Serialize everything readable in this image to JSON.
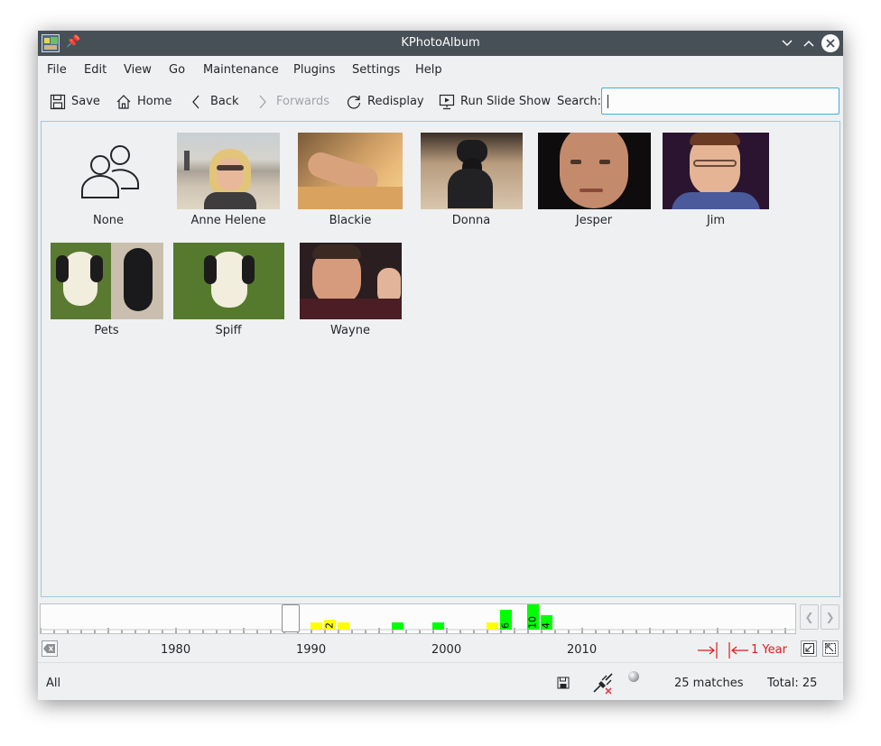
{
  "window": {
    "title": "KPhotoAlbum"
  },
  "menu": [
    "File",
    "Edit",
    "View",
    "Go",
    "Maintenance",
    "Plugins",
    "Settings",
    "Help"
  ],
  "toolbar": {
    "save": "Save",
    "home": "Home",
    "back": "Back",
    "forwards": "Forwards",
    "redisplay": "Redisplay",
    "slideshow": "Run Slide Show",
    "search_label": "Search:",
    "search_value": ""
  },
  "people": [
    {
      "name": "None",
      "icon": "people-icon"
    },
    {
      "name": "Anne Helene"
    },
    {
      "name": "Blackie"
    },
    {
      "name": "Donna"
    },
    {
      "name": "Jesper"
    },
    {
      "name": "Jim"
    },
    {
      "name": "Pets"
    },
    {
      "name": "Spiff"
    },
    {
      "name": "Wayne"
    }
  ],
  "timeline": {
    "axis_labels": [
      "1980",
      "1990",
      "2000",
      "2010"
    ],
    "unit_label": "1 Year",
    "colors": {
      "untagged": "#ffff00",
      "tagged": "#00ff00",
      "unit": "#e41a1a"
    },
    "bars": [
      {
        "year": 1990,
        "count": 1,
        "color": "yellow"
      },
      {
        "year": 1991,
        "count": 2,
        "color": "yellow",
        "label": "2"
      },
      {
        "year": 1992,
        "count": 1,
        "color": "yellow"
      },
      {
        "year": 1996,
        "count": 1,
        "color": "green"
      },
      {
        "year": 1999,
        "count": 1,
        "color": "green"
      },
      {
        "year": 2003,
        "count": 1,
        "color": "yellow"
      },
      {
        "year": 2004,
        "count": 6,
        "color": "green",
        "label": "6"
      },
      {
        "year": 2006,
        "count": 10,
        "color": "green",
        "label": "10"
      },
      {
        "year": 2007,
        "count": 4,
        "color": "green",
        "label": "4"
      }
    ]
  },
  "status": {
    "scope": "All",
    "matches": "25 matches",
    "total": "Total: 25"
  }
}
